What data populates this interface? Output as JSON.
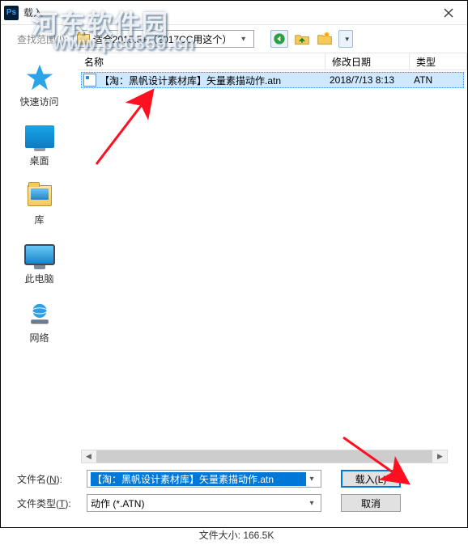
{
  "window": {
    "title": "载入",
    "ps_badge": "Ps"
  },
  "lookin": {
    "label_prefix": "查找范围(",
    "label_key": "I",
    "label_suffix": "):",
    "folder_name": "适合2015.5+（2017CC用这个）"
  },
  "toolbar": {
    "back": "back-icon",
    "up": "up-one-level-icon",
    "newfolder": "new-folder-icon",
    "viewmenu": "view-menu-icon"
  },
  "columns": {
    "name": "名称",
    "date": "修改日期",
    "type": "类型"
  },
  "files": [
    {
      "name": "【淘：黑帆设计素材库】矢量素描动作.atn",
      "date": "2018/7/13 8:13",
      "type": "ATN"
    }
  ],
  "places": [
    {
      "id": "quick-access",
      "label": "快速访问"
    },
    {
      "id": "desktop",
      "label": "桌面"
    },
    {
      "id": "libraries",
      "label": "库"
    },
    {
      "id": "this-pc",
      "label": "此电脑"
    },
    {
      "id": "network",
      "label": "网络"
    }
  ],
  "form": {
    "filename_label_prefix": "文件名(",
    "filename_label_key": "N",
    "filename_label_suffix": "):",
    "filename_value": "【淘：黑帆设计素材库】矢量素描动作.atn",
    "filetype_label_prefix": "文件类型(",
    "filetype_label_key": "T",
    "filetype_label_suffix": "):",
    "filetype_value": "动作 (*.ATN)",
    "load_button": "载入(L)",
    "cancel_button": "取消"
  },
  "footer": {
    "filesize_label": "文件大小:",
    "filesize_value": "166.5K"
  },
  "watermark": {
    "line1": "河东软件园",
    "line2": "www.pc0359.cn"
  }
}
